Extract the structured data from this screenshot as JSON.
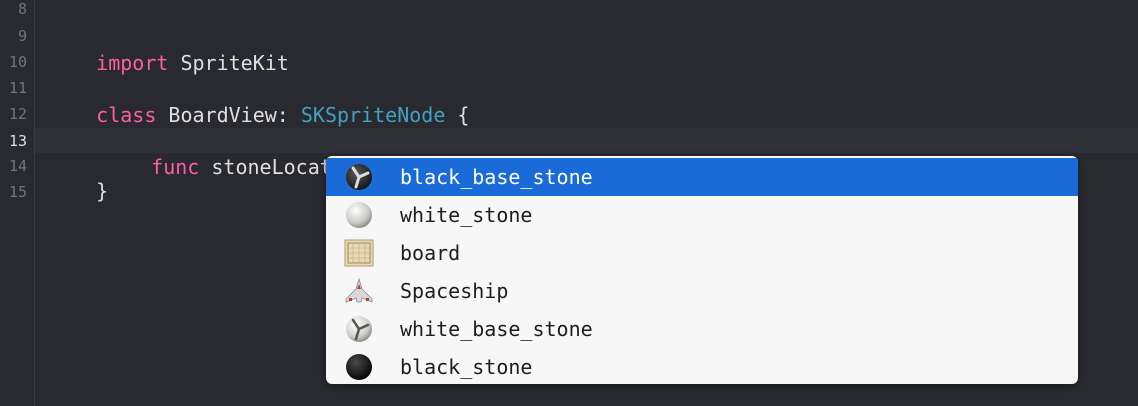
{
  "editor": {
    "line_numbers": [
      "8",
      "9",
      "10",
      "11",
      "12",
      "13",
      "14",
      "15"
    ],
    "current_line": "13",
    "code": {
      "l9_kw": "import",
      "l9_rest": " SpriteKit",
      "l11_kw": "class",
      "l11_name": " BoardView: ",
      "l11_type": "SKSpriteNode",
      "l11_brace": " {",
      "l13_kw": "func",
      "l13_rest": " stoneLocationFor(",
      "l14": "}"
    }
  },
  "completion": {
    "items": [
      {
        "label": "black_base_stone",
        "icon": "black-base-stone-icon",
        "selected": true
      },
      {
        "label": "white_stone",
        "icon": "white-stone-icon",
        "selected": false
      },
      {
        "label": "board",
        "icon": "board-icon",
        "selected": false
      },
      {
        "label": "Spaceship",
        "icon": "spaceship-icon",
        "selected": false
      },
      {
        "label": "white_base_stone",
        "icon": "white-base-stone-icon",
        "selected": false
      },
      {
        "label": "black_stone",
        "icon": "black-stone-icon",
        "selected": false
      }
    ]
  },
  "colors": {
    "background": "#292a30",
    "keyword": "#fc5fa3",
    "type": "#5dd8ff",
    "selection": "#1a6ad7"
  }
}
